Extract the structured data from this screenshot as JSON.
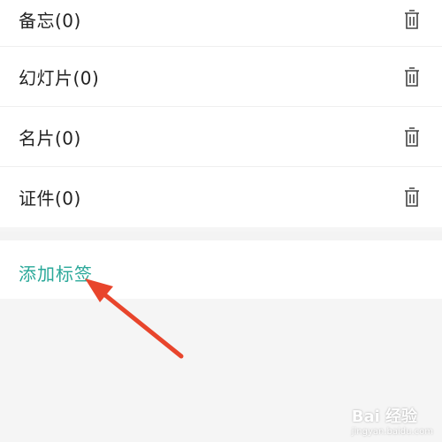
{
  "tags": [
    {
      "label": "备忘(0)",
      "icon": "trash-icon"
    },
    {
      "label": "幻灯片(0)",
      "icon": "trash-icon"
    },
    {
      "label": "名片(0)",
      "icon": "trash-icon"
    },
    {
      "label": "证件(0)",
      "icon": "trash-icon"
    }
  ],
  "add_tag_label": "添加标签",
  "watermark": {
    "logo_text": "Bai 经验",
    "url": "jingyan.baidu.com"
  },
  "colors": {
    "accent": "#2aa899",
    "arrow": "#e8452c",
    "background": "#f5f5f5"
  }
}
